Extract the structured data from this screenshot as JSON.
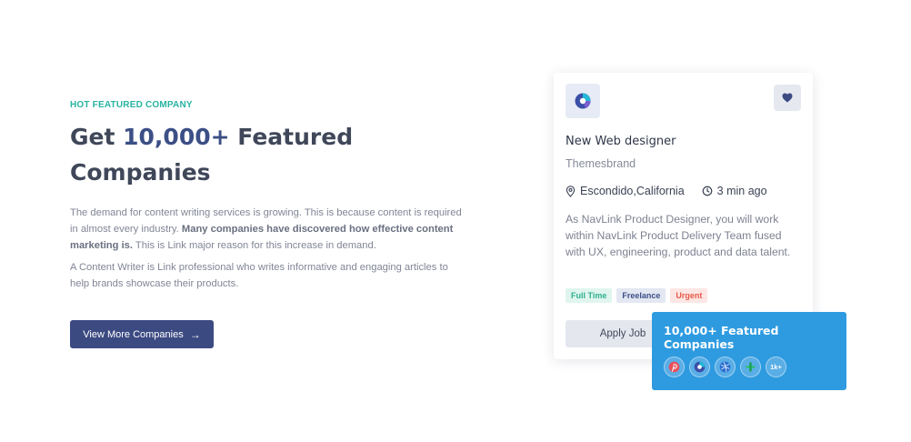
{
  "hero": {
    "eyebrow": "HOT FEATURED COMPANY",
    "headline_prefix": "Get ",
    "headline_accent": "10,000+",
    "headline_suffix": " Featured Companies",
    "paragraph1_a": "The demand for content writing services is growing. This is because content is required in almost every industry. ",
    "paragraph1_bold": "Many companies have discovered how effective content marketing is.",
    "paragraph1_b": " This is Link major reason for this increase in demand.",
    "paragraph2": "A Content Writer is Link professional who writes informative and engaging articles to help brands showcase their products.",
    "cta_label": "View More Companies",
    "cta_arrow": "→"
  },
  "job_card": {
    "title": "New Web designer",
    "company": "Themesbrand",
    "location": "Escondido,California",
    "posted": "3 min ago",
    "description": "As NavLink Product Designer, you will work within NavLink Product Delivery Team fused with UX, engineering, product and data talent.",
    "tags": [
      "Full Time",
      "Freelance",
      "Urgent"
    ],
    "apply_label": "Apply Job",
    "icons": {
      "logo": "company-logo-icon",
      "favorite": "heart-icon",
      "location": "map-pin-icon",
      "time": "clock-icon"
    }
  },
  "featured_badge": {
    "title": "10,000+ Featured Companies",
    "more_label": "1k+",
    "avatar_icons": [
      "pinterest-icon",
      "company-logo-icon",
      "dribbble-icon",
      "slack-icon"
    ]
  },
  "colors": {
    "accent": "#3c4a82",
    "eyebrow": "#28b3a0",
    "badge_bg": "#2e9be0"
  }
}
